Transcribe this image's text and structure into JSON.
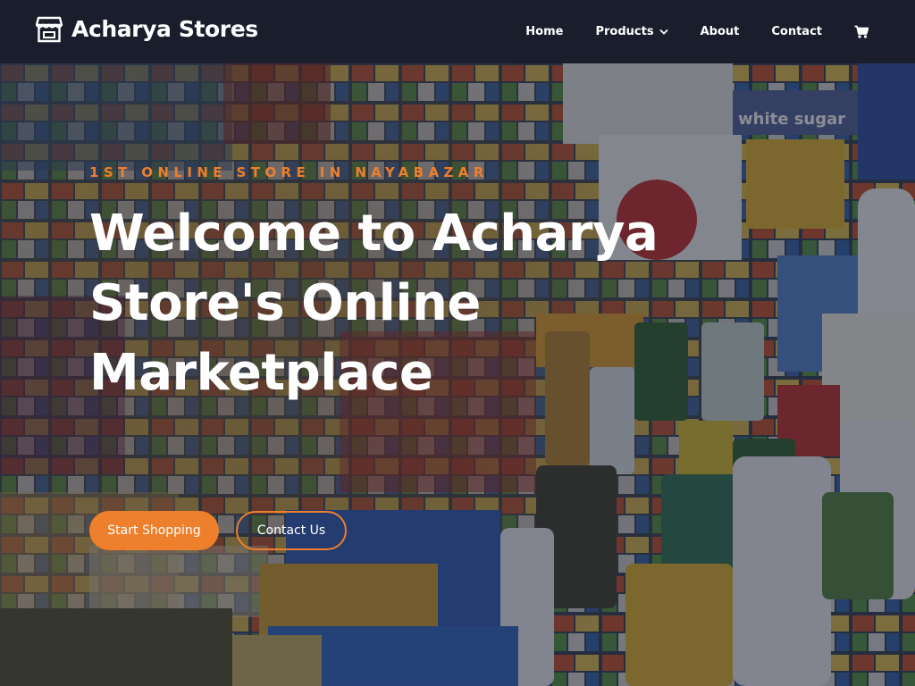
{
  "header": {
    "brand_name": "Acharya Stores",
    "brand_icon": "store-icon",
    "nav": {
      "home": "Home",
      "products": "Products",
      "about": "About",
      "contact": "Contact"
    },
    "cart_icon": "cart-icon"
  },
  "hero": {
    "tagline": "1ST ONLINE STORE IN NAYABAZAR",
    "title": "Welcome to Acharya Store's Online Marketplace",
    "primary_button": "Start Shopping",
    "secondary_button": "Contact Us"
  },
  "colors": {
    "accent": "#ee7f2c",
    "header_bg": "#1a1e2c",
    "text": "#ffffff"
  }
}
